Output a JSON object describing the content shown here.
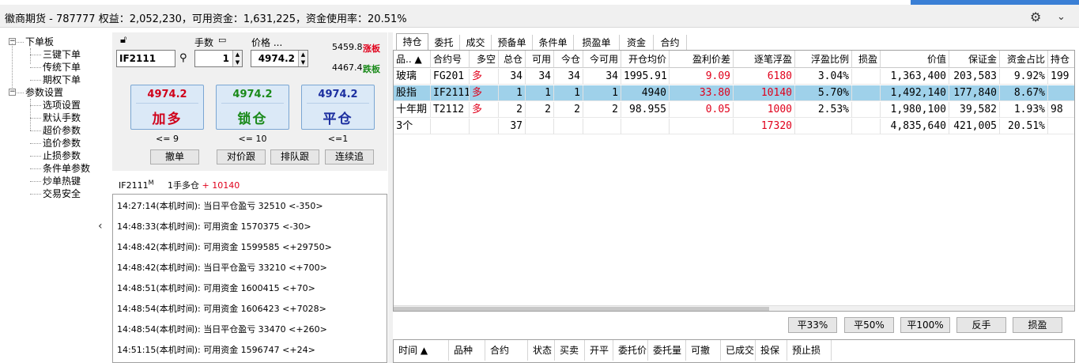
{
  "window": {
    "title": "徽商期货 - 787777  权益：2,052,230，可用资金：1,631,225，资金使用率：20.51%"
  },
  "tree": [
    {
      "label": "下单板",
      "expander": "⊟",
      "level": 0
    },
    {
      "label": "三键下单",
      "level": 1
    },
    {
      "label": "传统下单",
      "level": 1
    },
    {
      "label": "期权下单",
      "level": 1
    },
    {
      "label": "参数设置",
      "expander": "⊟",
      "level": 0
    },
    {
      "label": "选项设置",
      "level": 1
    },
    {
      "label": "默认手数",
      "level": 1
    },
    {
      "label": "超价参数",
      "level": 1
    },
    {
      "label": "追价参数",
      "level": 1
    },
    {
      "label": "止损参数",
      "level": 1
    },
    {
      "label": "条件单参数",
      "level": 1
    },
    {
      "label": "炒单热键",
      "level": 1
    },
    {
      "label": "交易安全",
      "level": 1
    }
  ],
  "order": {
    "contract": "IF2111",
    "lots_label": "手数",
    "lots": "1",
    "price_label": "价格 ...",
    "price": "4974.2",
    "limit_up": "5459.8",
    "limit_up_label": "涨板",
    "limit_down": "4467.4",
    "limit_down_label": "跌板",
    "buttons": [
      {
        "price": "4974.2",
        "action": "加多",
        "limit": "<= 9",
        "color": "#d0021b"
      },
      {
        "price": "4974.2",
        "action": "锁仓",
        "limit": "<= 10",
        "color": "#1a8a1a"
      },
      {
        "price": "4974.2",
        "action": "平仓",
        "limit": "<=1",
        "color": "#1c2fa0"
      }
    ],
    "small_buttons": [
      "撤单",
      "对价跟",
      "排队跟",
      "连续追"
    ]
  },
  "position_info": {
    "contract": "IF2111",
    "sup": "M",
    "text": "1手多仓",
    "pnl": "+ 10140"
  },
  "log": [
    "14:27:14(本机时间): 当日平仓盈亏 32510  <-350>",
    "14:48:33(本机时间): 可用资金 1570375  <-30>",
    "14:48:42(本机时间): 可用资金 1599585  <+29750>",
    "14:48:42(本机时间): 当日平仓盈亏 33210  <+700>",
    "14:48:51(本机时间): 可用资金 1600415  <+70>",
    "14:48:54(本机时间): 可用资金 1606423  <+7028>",
    "14:48:54(本机时间): 当日平仓盈亏 33470  <+260>",
    "14:51:15(本机时间): 可用资金 1596747  <+24>"
  ],
  "tabs": [
    "持仓",
    "委托",
    "成交",
    "预备单",
    "条件单",
    "损盈单",
    "资金",
    "合约"
  ],
  "columns": [
    "品.. ▲",
    "合约号",
    "多空",
    "总仓",
    "可用",
    "今仓",
    "今可用",
    "开仓均价",
    "盈利价差",
    "逐笔浮盈",
    "浮盈比例",
    "损盈",
    "价值",
    "保证金",
    "资金占比",
    "持仓"
  ],
  "rows": [
    [
      "玻璃",
      "FG201",
      "多",
      "34",
      "34",
      "34",
      "34",
      "1995.91",
      "9.09",
      "6180",
      "3.04%",
      "",
      "1,363,400",
      "203,583",
      "9.92%",
      "199"
    ],
    [
      "股指",
      "IF2111",
      "多",
      "1",
      "1",
      "1",
      "1",
      "4940",
      "33.80",
      "10140",
      "5.70%",
      "",
      "1,492,140",
      "177,840",
      "8.67%",
      ""
    ],
    [
      "十年期",
      "T2112",
      "多",
      "2",
      "2",
      "2",
      "2",
      "98.955",
      "0.05",
      "1000",
      "2.53%",
      "",
      "1,980,100",
      "39,582",
      "1.93%",
      "98"
    ],
    [
      "3个",
      "",
      "",
      "37",
      "",
      "",
      "",
      "",
      "",
      "17320",
      "",
      "",
      "4,835,640",
      "421,005",
      "20.51%",
      ""
    ]
  ],
  "action_buttons": [
    "平33%",
    "平50%",
    "平100%",
    "反手",
    "损盈"
  ],
  "order_columns": [
    "时间 ▲",
    "品种",
    "合约",
    "状态",
    "买卖",
    "开平",
    "委托价",
    "委托量",
    "可撤",
    "已成交",
    "投保",
    "预止损"
  ],
  "icons": {
    "settings": "gear-icon",
    "dropdown": "chevron-down-icon"
  }
}
